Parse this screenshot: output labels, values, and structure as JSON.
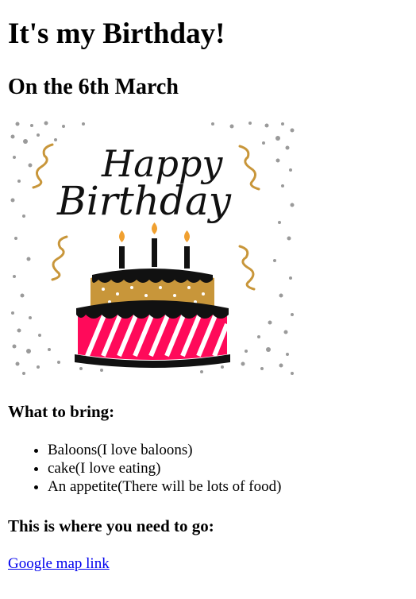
{
  "page": {
    "title": "It's my Birthday!",
    "date": "On the 6th March"
  },
  "image": {
    "alt": "Happy Birthday cake",
    "text_line1": "Happy",
    "text_line2": "Birthday",
    "colors": {
      "gold": "#C8963A",
      "pink": "#FF0A5A",
      "black": "#111111",
      "dots": "#9A9A9A",
      "flame": "#F0A030"
    }
  },
  "bring": {
    "heading": "What to bring:",
    "items": [
      "Baloons(I love baloons)",
      "cake(I love eating)",
      "An appetite(There will be lots of food)"
    ]
  },
  "directions": {
    "heading": "This is where you need to go:",
    "link_text": "Google map link"
  }
}
